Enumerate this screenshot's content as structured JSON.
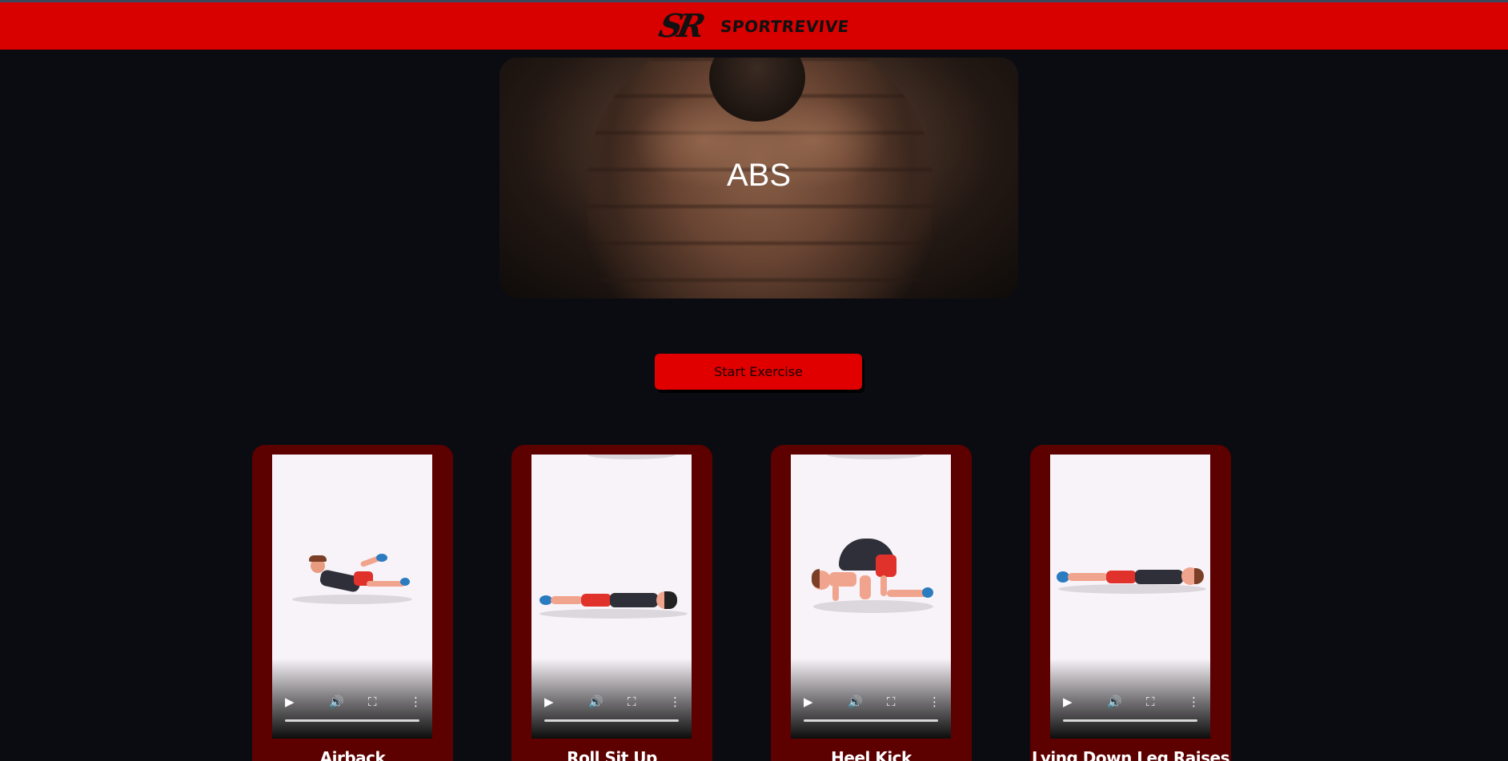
{
  "header": {
    "logo_text": "SR",
    "brand": "SPORTREVIVE"
  },
  "hero": {
    "title": "ABS"
  },
  "actions": {
    "start_label": "Start Exercise"
  },
  "exercises": [
    {
      "title": "Airback"
    },
    {
      "title": "Roll Sit Up"
    },
    {
      "title": "Heel Kick"
    },
    {
      "title": "Lying Down Leg Raises"
    }
  ],
  "video_controls": {
    "play_icon": "play-icon",
    "volume_icon": "volume-icon",
    "fullscreen_icon": "fullscreen-icon",
    "menu_icon": "more-options-icon"
  },
  "colors": {
    "header_red": "#d90000",
    "page_bg": "#0b0c11",
    "card_bg": "#5c0000",
    "button_red": "#e00000"
  }
}
